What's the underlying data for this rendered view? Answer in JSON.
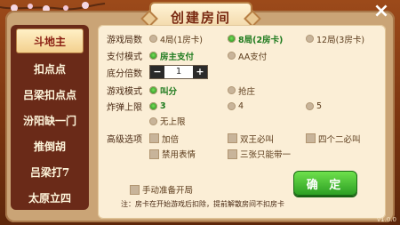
{
  "title": "创建房间",
  "close_icon": "×",
  "nav": [
    {
      "label": "斗地主",
      "active": true
    },
    {
      "label": "扣点点"
    },
    {
      "label": "吕梁扣点点"
    },
    {
      "label": "汾阳缺一门"
    },
    {
      "label": "推倒胡"
    },
    {
      "label": "吕梁打7"
    },
    {
      "label": "太原立四"
    }
  ],
  "sections": {
    "rounds": {
      "label": "游戏局数",
      "options": [
        "4局(1房卡)",
        "8局(2房卡)",
        "12局(3房卡)"
      ],
      "selected": 1
    },
    "payment": {
      "label": "支付模式",
      "options": [
        "房主支付",
        "AA支付"
      ],
      "selected": 0
    },
    "multiplier": {
      "label": "底分倍数",
      "value": "1",
      "minus": "−",
      "plus": "+"
    },
    "game_mode": {
      "label": "游戏模式",
      "options": [
        "叫分",
        "抢庄"
      ],
      "selected": 0
    },
    "bomb_limit": {
      "label": "炸弹上限",
      "options": [
        "3",
        "4",
        "5",
        "无上限"
      ],
      "selected": 0
    },
    "advanced": {
      "label": "高级选项",
      "options": [
        "加倍",
        "双王必叫",
        "四个二必叫",
        "禁用表情",
        "三张只能带一"
      ]
    }
  },
  "manual_start": "手动准备开局",
  "confirm": "确  定",
  "note": "注：房卡在开始游戏后扣除，提前解散房间不扣房卡",
  "version": "v1.0.0"
}
